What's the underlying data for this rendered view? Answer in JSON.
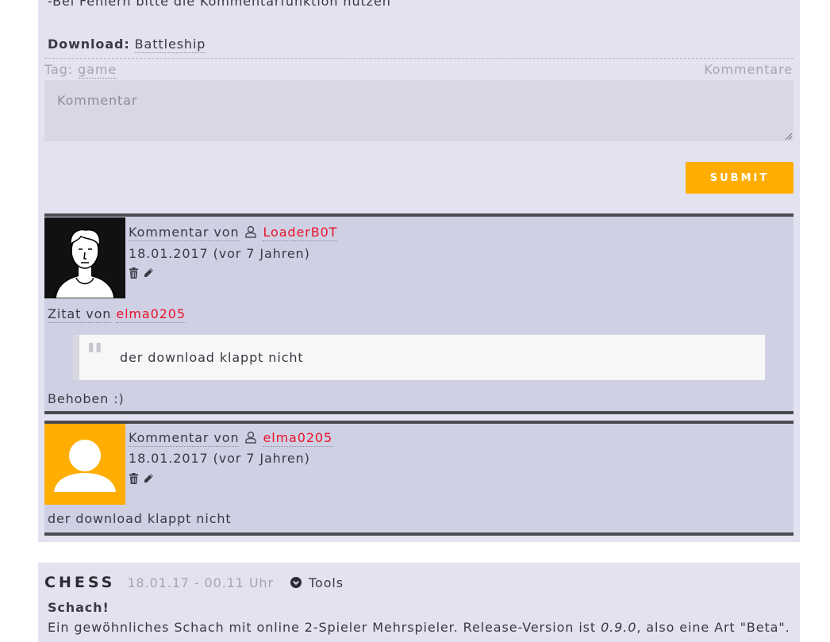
{
  "post1": {
    "intro_line": "-Bei Fehlern bitte die Kommentarfunktion nutzen",
    "download_label": "Download:",
    "download_link": "Battleship",
    "tag_label": "Tag:",
    "tag_value": "game",
    "comments_link": "Kommentare"
  },
  "comment_form": {
    "placeholder": "Kommentar",
    "submit_label": "SUBMIT"
  },
  "comments": [
    {
      "by_label": "Kommentar von",
      "author": "LoaderB0T",
      "date": "18.01.2017 (vor 7 Jahren)",
      "quote_label": "Zitat von",
      "quote_author": "elma0205",
      "quote_text": "der download klappt nicht",
      "text": "Behoben :)"
    },
    {
      "by_label": "Kommentar von",
      "author": "elma0205",
      "date": "18.01.2017 (vor 7 Jahren)",
      "text": "der download klappt nicht"
    }
  ],
  "post2": {
    "title": "CHESS",
    "date": "18.01.17 - 00.11 Uhr",
    "category": "Tools",
    "heading": "Schach!",
    "text_start": "Ein gewöhnliches Schach mit online 2-Spieler Mehrspieler. Release-Version ist",
    "version": "0.9.0",
    "text_end": ", also eine Art \"Beta\"."
  },
  "colors": {
    "accent": "#ffad00",
    "author_red": "#e8132a",
    "panel": "#e2e2f0",
    "comment_bg": "#d0d0e4"
  },
  "icons": [
    "user-outline-icon",
    "trash-icon",
    "pencil-icon",
    "quote-mark-icon",
    "chevron-circle-down-icon",
    "resize-grip-icon"
  ]
}
